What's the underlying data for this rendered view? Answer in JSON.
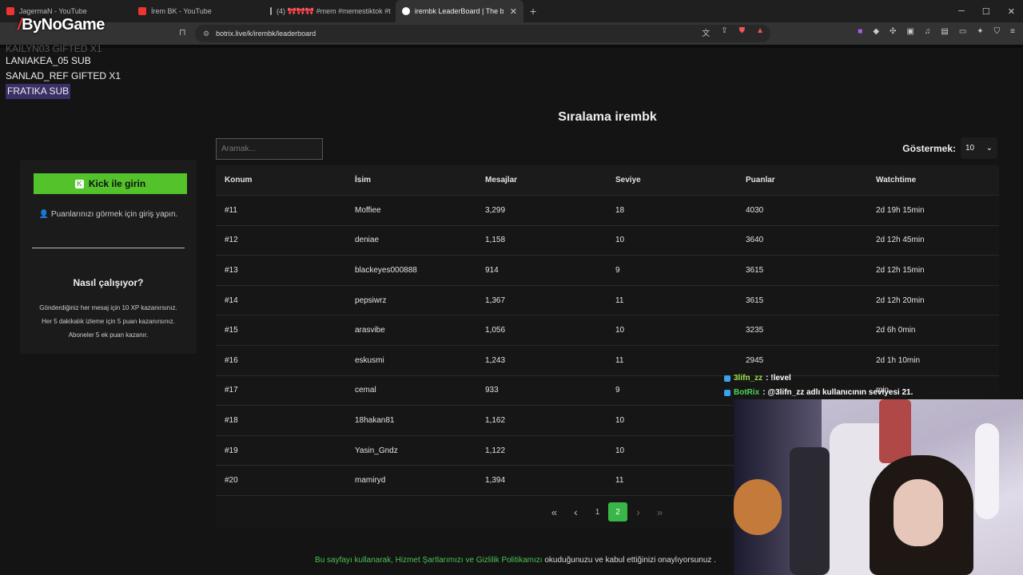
{
  "browser": {
    "tabs": [
      {
        "title": "JagermaN - YouTube",
        "color": "#e33"
      },
      {
        "title": "İrem BK - YouTube",
        "color": "#e33"
      },
      {
        "title": "(4) 🎀🎀🎀 #mem #memestiktok #t",
        "color": "#fff"
      },
      {
        "title": "irembk LeaderBoard | The best C",
        "color": "#fff"
      }
    ],
    "new_tab": "+",
    "url": "botrix.live/k/irembk/leaderboard",
    "win_min": "─",
    "win_max": "☐",
    "win_close": "✕"
  },
  "overlay": {
    "logo": "ByNoGame",
    "alerts": [
      {
        "text": "KAILYN03  GIFTED X1"
      },
      {
        "text": "LANIAKEA_05  SUB"
      },
      {
        "text": "SANLAD_REF  GIFTED X1"
      },
      {
        "text": "FRATIKA  SUB"
      }
    ],
    "chat": [
      {
        "user": "3lifn_zz",
        "msg": " : !level"
      },
      {
        "user": "BotRix",
        "msg": " : @3lifn_zz adlı kullanıcının seviyesi 21."
      }
    ]
  },
  "page": {
    "title": "Sıralama irembk",
    "search_placeholder": "Aramak...",
    "show_label": "Göstermek:",
    "show_value": "10",
    "login_button": "Kick ile girin",
    "login_hint": "Puanlarınızı görmek için giriş yapın.",
    "how_title": "Nasıl çalışıyor?",
    "how_lines": [
      "Gönderdiğiniz her mesaj için 10 XP kazanırsınız.",
      "Her 5 dakikalık izleme için 5 puan kazanırsınız.",
      "Aboneler 5 ek puan kazanır."
    ],
    "columns": [
      "Konum",
      "İsim",
      "Mesajlar",
      "Seviye",
      "Puanlar",
      "Watchtime"
    ],
    "rows": [
      [
        "#11",
        "Moffiee",
        "3,299",
        "18",
        "4030",
        "2d 19h 15min"
      ],
      [
        "#12",
        "deniae",
        "1,158",
        "10",
        "3640",
        "2d 12h 45min"
      ],
      [
        "#13",
        "blackeyes000888",
        "914",
        "9",
        "3615",
        "2d 12h 15min"
      ],
      [
        "#14",
        "pepsiwrz",
        "1,367",
        "11",
        "3615",
        "2d 12h 20min"
      ],
      [
        "#15",
        "arasvibe",
        "1,056",
        "10",
        "3235",
        "2d 6h 0min"
      ],
      [
        "#16",
        "eskusmi",
        "1,243",
        "11",
        "2945",
        "2d 1h 10min"
      ],
      [
        "#17",
        "cemal",
        "933",
        "9",
        "",
        "min"
      ],
      [
        "#18",
        "18hakan81",
        "1,162",
        "10",
        "",
        ""
      ],
      [
        "#19",
        "Yasin_Gndz",
        "1,122",
        "10",
        "",
        ""
      ],
      [
        "#20",
        "mamiryd",
        "1,394",
        "11",
        "",
        ""
      ]
    ],
    "pagination": {
      "first": "«",
      "prev": "‹",
      "page1": "1",
      "current": "2",
      "next": "›",
      "last": "»"
    },
    "footer_link": "Bu sayfayı kullanarak, Hizmet Şartlarımızı ve Gizlilik Politikamızı",
    "footer_rest": " okuduğunuzu ve kabul ettiğinizi onaylıyorsunuz ."
  }
}
